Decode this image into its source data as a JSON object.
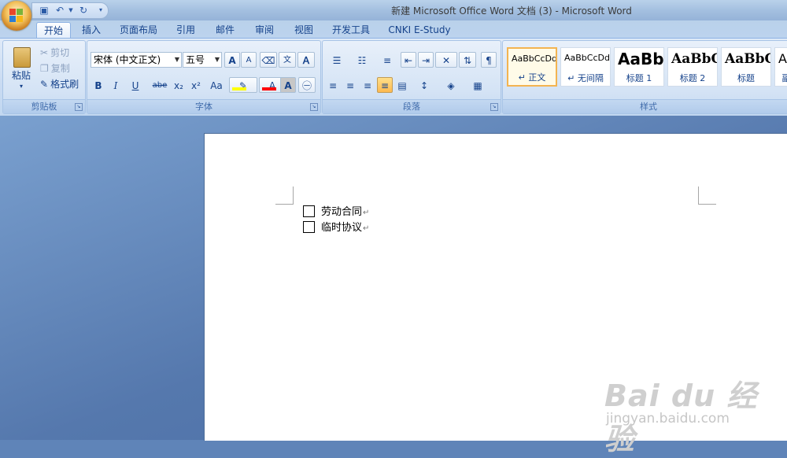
{
  "window": {
    "title": "新建 Microsoft Office Word 文档 (3) - Microsoft Word"
  },
  "tabs": [
    "开始",
    "插入",
    "页面布局",
    "引用",
    "邮件",
    "审阅",
    "视图",
    "开发工具",
    "CNKI E-Study"
  ],
  "clipboard": {
    "paste": "粘贴",
    "cut": "剪切",
    "copy": "复制",
    "format_painter": "格式刷",
    "label": "剪贴板"
  },
  "font": {
    "name": "宋体 (中文正文)",
    "size": "五号",
    "label": "字体",
    "bold": "B",
    "italic": "I",
    "underline": "U",
    "strike": "abe",
    "subscript": "x₂",
    "superscript": "x²",
    "case": "Aa",
    "grow": "A",
    "shrink": "A",
    "color_letter": "A"
  },
  "paragraph": {
    "label": "段落"
  },
  "styles": {
    "label": "样式",
    "items": [
      {
        "sample": "AaBbCcDd",
        "name": "↵ 正文"
      },
      {
        "sample": "AaBbCcDd",
        "name": "↵ 无间隔"
      },
      {
        "sample": "AaBb",
        "name": "标题 1"
      },
      {
        "sample": "AaBbC",
        "name": "标题 2"
      },
      {
        "sample": "AaBbC",
        "name": "标题"
      },
      {
        "sample": "Aa",
        "name": "副"
      }
    ]
  },
  "document": {
    "items": [
      {
        "label": "劳动合同",
        "checked": false
      },
      {
        "label": "临时协议",
        "checked": false
      }
    ],
    "para_mark": "↵"
  },
  "watermark": {
    "logo": "Bai du 经验",
    "url": "jingyan.baidu.com"
  },
  "colors": {
    "highlight": "#ffff00",
    "font_color": "#ff0000",
    "accent": "#15428b"
  }
}
